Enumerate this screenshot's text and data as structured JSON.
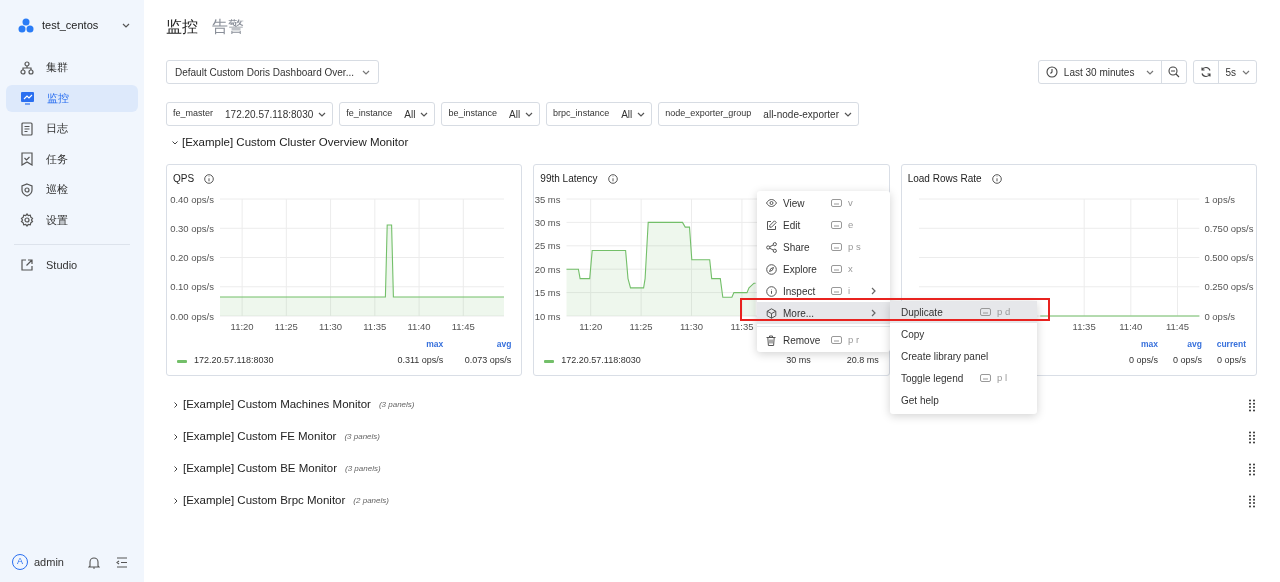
{
  "sidebar": {
    "cluster": "test_centos",
    "items": [
      {
        "label": "集群",
        "selected": false
      },
      {
        "label": "监控",
        "selected": true
      },
      {
        "label": "日志",
        "selected": false
      },
      {
        "label": "任务",
        "selected": false
      },
      {
        "label": "巡检",
        "selected": false
      },
      {
        "label": "设置",
        "selected": false
      }
    ],
    "links": [
      {
        "label": "Studio"
      }
    ],
    "user": {
      "initial": "A",
      "name": "admin"
    }
  },
  "page_tabs": [
    {
      "label": "监控",
      "selected": true
    },
    {
      "label": "告警",
      "selected": false
    }
  ],
  "dashboard_select": "Default Custom Doris Dashboard Over...",
  "time_range": "Last 30 minutes",
  "refresh_interval": "5s",
  "variables": [
    {
      "name": "fe_master",
      "value": "172.20.57.118:8030"
    },
    {
      "name": "fe_instance",
      "value": "All"
    },
    {
      "name": "be_instance",
      "value": "All"
    },
    {
      "name": "brpc_instance",
      "value": "All"
    },
    {
      "name": "node_exporter_group",
      "value": "all-node-exporter"
    }
  ],
  "sections": [
    {
      "title": "[Example] Custom Cluster Overview Monitor",
      "expanded": true,
      "panels": [
        {
          "title": "QPS",
          "y_axis_right": false,
          "chart_data": {
            "type": "area",
            "grid": true,
            "ylim": [
              0,
              0.4
            ],
            "xlim": [
              677.5,
              709.6
            ],
            "yticks": [
              {
                "value": 0,
                "label": "0.00 ops/s"
              },
              {
                "value": 0.1,
                "label": "0.10 ops/s"
              },
              {
                "value": 0.2,
                "label": "0.20 ops/s"
              },
              {
                "value": 0.3,
                "label": "0.30 ops/s"
              },
              {
                "value": 0.4,
                "label": "0.40 ops/s"
              }
            ],
            "xticks": [
              {
                "value": 680,
                "label": "11:20"
              },
              {
                "value": 685,
                "label": "11:25"
              },
              {
                "value": 690,
                "label": "11:30"
              },
              {
                "value": 695,
                "label": "11:35"
              },
              {
                "value": 700,
                "label": "11:40"
              },
              {
                "value": 705,
                "label": "11:45"
              }
            ],
            "x": [
              677.5,
              696.2,
              696.4,
              696.9,
              697.1,
              709.6
            ],
            "series": [
              {
                "name": "172.20.57.118:8030",
                "color": "#73bf69",
                "values": [
                  0.065,
                  0.065,
                  0.311,
                  0.311,
                  0.065,
                  0.065
                ]
              }
            ]
          },
          "legend": {
            "headers": [
              "max",
              "avg"
            ],
            "values": [
              "0.311 ops/s",
              "0.073 ops/s"
            ]
          }
        },
        {
          "title": "99th Latency",
          "y_axis_right": false,
          "chart_data": {
            "type": "area",
            "grid": true,
            "ylim": [
              10,
              35
            ],
            "xlim": [
              677.6,
              707.8
            ],
            "yticks": [
              {
                "value": 10,
                "label": "10 ms"
              },
              {
                "value": 15,
                "label": "15 ms"
              },
              {
                "value": 20,
                "label": "20 ms"
              },
              {
                "value": 25,
                "label": "25 ms"
              },
              {
                "value": 30,
                "label": "30 ms"
              },
              {
                "value": 35,
                "label": "35 ms"
              }
            ],
            "xticks": [
              {
                "value": 680,
                "label": "11:20"
              },
              {
                "value": 685,
                "label": "11:25"
              },
              {
                "value": 690,
                "label": "11:30"
              },
              {
                "value": 695,
                "label": "11:35"
              }
            ],
            "x": [
              677.6,
              678.78,
              678.95,
              679.9,
              680.15,
              683.46,
              683.7,
              683.95,
              685.25,
              685.4,
              685.7,
              689.1,
              689.37,
              689.8,
              690.03,
              691.8,
              692.0,
              692.85,
              693.1,
              694.0,
              694.2,
              695.5,
              695.7,
              696.2,
              696.35
            ],
            "series": [
              {
                "name": "172.20.57.118:8030",
                "color": "#73bf69",
                "values": [
                  20,
                  20,
                  18,
                  18,
                  24,
                  24,
                  18,
                  16,
                  16,
                  18,
                  30,
                  30,
                  29,
                  29,
                  22,
                  22,
                  18,
                  18,
                  14,
                  14,
                  15,
                  15,
                  16,
                  17,
                  17
                ]
              }
            ]
          },
          "legend": {
            "values": [
              "30 ms",
              "20.8 ms"
            ]
          }
        },
        {
          "title": "Load Rows Rate",
          "y_axis_right": true,
          "chart_data": {
            "type": "line",
            "grid": true,
            "ylim": [
              0,
              1
            ],
            "xlim": [
              677.3,
              707.35
            ],
            "yticks": [
              {
                "value": 0,
                "label": "0 ops/s"
              },
              {
                "value": 0.25,
                "label": "0.250 ops/s"
              },
              {
                "value": 0.5,
                "label": "0.500 ops/s"
              },
              {
                "value": 0.75,
                "label": "0.750 ops/s"
              },
              {
                "value": 1,
                "label": "1 ops/s"
              }
            ],
            "xticks": [
              {
                "value": 695,
                "label": "11:35"
              },
              {
                "value": 700,
                "label": "11:40"
              },
              {
                "value": 705,
                "label": "11:45"
              }
            ],
            "x": [
              690.3,
              707.35
            ],
            "series": [
              {
                "color": "#73bf69",
                "values": [
                  0,
                  0
                ]
              }
            ]
          },
          "legend": {
            "headers": [
              "max",
              "avg",
              "current"
            ],
            "values": [
              "0 ops/s",
              "0 ops/s",
              "0 ops/s"
            ]
          }
        }
      ]
    },
    {
      "title": "[Example] Custom Machines Monitor",
      "expanded": false,
      "panel_count": "(3 panels)"
    },
    {
      "title": "[Example] Custom FE Monitor",
      "expanded": false,
      "panel_count": "(3 panels)"
    },
    {
      "title": "[Example] Custom BE Monitor",
      "expanded": false,
      "panel_count": "(3 panels)"
    },
    {
      "title": "[Example] Custom Brpc Monitor",
      "expanded": false,
      "panel_count": "(2 panels)"
    }
  ],
  "context_menu": {
    "items": [
      {
        "label": "View",
        "shortcut": "v",
        "has_submenu": false,
        "highlighted": false,
        "divider_before": false
      },
      {
        "label": "Edit",
        "shortcut": "e",
        "has_submenu": false,
        "highlighted": false,
        "divider_before": false
      },
      {
        "label": "Share",
        "shortcut": "p s",
        "has_submenu": false,
        "highlighted": false,
        "divider_before": false
      },
      {
        "label": "Explore",
        "shortcut": "x",
        "has_submenu": false,
        "highlighted": false,
        "divider_before": false
      },
      {
        "label": "Inspect",
        "shortcut": "i",
        "has_submenu": true,
        "highlighted": false,
        "divider_before": false
      },
      {
        "label": "More...",
        "has_submenu": true,
        "highlighted": true,
        "divider_before": false
      },
      {
        "label": "Remove",
        "shortcut": "p r",
        "has_submenu": false,
        "highlighted": false,
        "divider_before": true
      }
    ]
  },
  "submenu": {
    "items": [
      {
        "label": "Duplicate",
        "shortcut": "p d",
        "highlighted": true
      },
      {
        "label": "Copy",
        "highlighted": false
      },
      {
        "label": "Create library panel",
        "highlighted": false
      },
      {
        "label": "Toggle legend",
        "shortcut": "p l",
        "highlighted": false
      },
      {
        "label": "Get help",
        "highlighted": false
      }
    ]
  }
}
